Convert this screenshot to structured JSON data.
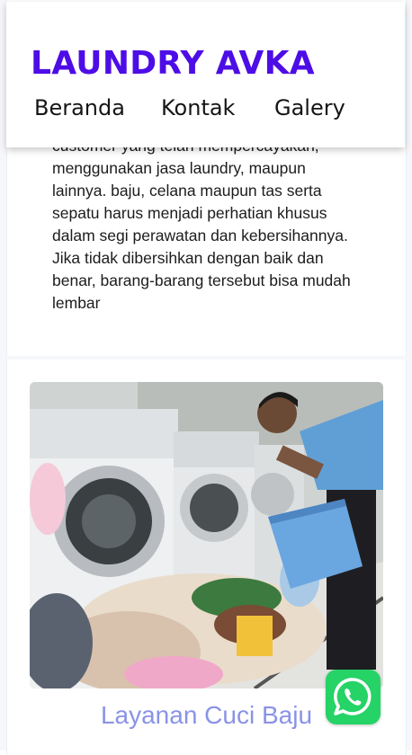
{
  "header": {
    "brand": "LAUNDRY AVKA",
    "nav": [
      "Beranda",
      "Kontak",
      "Galery"
    ]
  },
  "article": {
    "text": "customer yang telah mempercayakan, menggunakan jasa laundry, maupun lainnya. baju, celana maupun tas serta sepatu harus menjadi perhatian khusus dalam segi perawatan dan kebersihannya. Jika tidak dibersihkan dengan baik dan benar, barang-barang tersebut bisa mudah lembar"
  },
  "gallery": {
    "caption": "Layanan Cuci Baju"
  },
  "whatsapp": {
    "icon": "whatsapp-icon",
    "color": "#25d366"
  },
  "colors": {
    "brand": "#4d0de6",
    "caption": "#8a93e6"
  }
}
